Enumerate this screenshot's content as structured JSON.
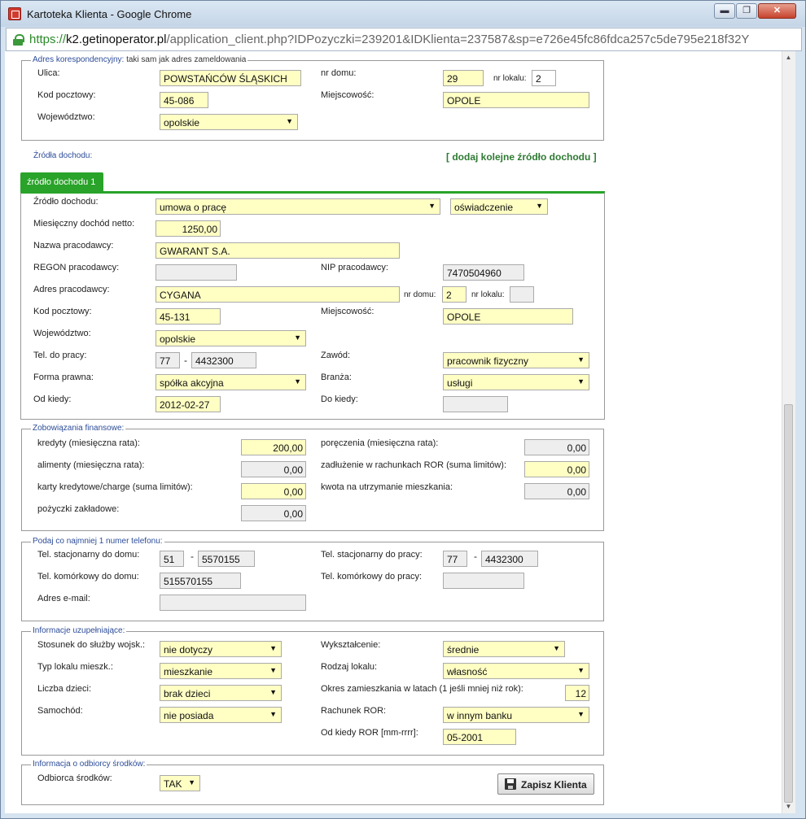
{
  "window": {
    "title": "Kartoteka Klienta - Google Chrome",
    "min": "▬",
    "max": "❐",
    "close": "✕"
  },
  "address": {
    "scheme": "https://",
    "host": "k2.getinoperator.pl",
    "path": "/application_client.php?IDPozyczki=239201&IDKlienta=237587&sp=e726e45fc86fdca257c5de795e218f32Y"
  },
  "corr": {
    "legend": "Adres korespondencyjny:",
    "legend_sub": "taki sam jak adres zameldowania",
    "ulica_label": "Ulica:",
    "ulica": "POWSTAŃCÓW ŚLĄSKICH",
    "nr_domu_label": "nr domu:",
    "nr_domu": "29",
    "nr_lokalu_label": "nr lokalu:",
    "nr_lokalu": "2",
    "kod_label": "Kod pocztowy:",
    "kod": "45-086",
    "miejsc_label": "Miejscowość:",
    "miejsc": "OPOLE",
    "woj_label": "Województwo:",
    "woj": "opolskie"
  },
  "income": {
    "section_label": "Źródła dochodu:",
    "add_link": "[ dodaj kolejne źródło dochodu ]",
    "tab": "źródło dochodu 1",
    "zrodlo_label": "Źródło dochodu:",
    "zrodlo": "umowa o pracę",
    "dokument": "oświadczenie",
    "dochod_label": "Miesięczny dochód netto:",
    "dochod": "1250,00",
    "nazwa_label": "Nazwa pracodawcy:",
    "nazwa": "GWARANT S.A.",
    "regon_label": "REGON pracodawcy:",
    "regon": "",
    "nip_label": "NIP pracodawcy:",
    "nip": "7470504960",
    "adres_label": "Adres pracodawcy:",
    "adres": "CYGANA",
    "nr_domu_label": "nr domu:",
    "nr_domu": "2",
    "nr_lokalu_label": "nr lokalu:",
    "nr_lokalu": "",
    "kod_label": "Kod pocztowy:",
    "kod": "45-131",
    "miejsc_label": "Miejscowość:",
    "miejsc": "OPOLE",
    "woj_label": "Województwo:",
    "woj": "opolskie",
    "tel_label": "Tel. do pracy:",
    "tel_kier": "77",
    "tel_dash": "-",
    "tel_num": "4432300",
    "zawod_label": "Zawód:",
    "zawod": "pracownik fizyczny",
    "forma_label": "Forma prawna:",
    "forma": "spółka akcyjna",
    "branza_label": "Branża:",
    "branza": "usługi",
    "od_label": "Od kiedy:",
    "od": "2012-02-27",
    "do_label": "Do kiedy:",
    "do": ""
  },
  "fin": {
    "legend": "Zobowiązania finansowe:",
    "kredyty_label": "kredyty (miesięczna rata):",
    "kredyty": "200,00",
    "poreczenia_label": "poręczenia (miesięczna rata):",
    "poreczenia": "0,00",
    "alimenty_label": "alimenty (miesięczna rata):",
    "alimenty": "0,00",
    "zadluzenie_label": "zadłużenie w rachunkach ROR (suma limitów):",
    "zadluzenie": "0,00",
    "karty_label": "karty kredytowe/charge (suma limitów):",
    "karty": "0,00",
    "kwota_label": "kwota na utrzymanie mieszkania:",
    "kwota": "0,00",
    "pozyczki_label": "pożyczki zakładowe:",
    "pozyczki": "0,00"
  },
  "phone": {
    "legend": "Podaj co najmniej 1 numer telefonu:",
    "dom_label": "Tel. stacjonarny do domu:",
    "dom_kier": "51",
    "dom_num": "5570155",
    "dash": "-",
    "praca_label": "Tel. stacjonarny do pracy:",
    "praca_kier": "77",
    "praca_num": "4432300",
    "kom_dom_label": "Tel. komórkowy do domu:",
    "kom_dom": "515570155",
    "kom_praca_label": "Tel. komórkowy do pracy:",
    "kom_praca": "",
    "email_label": "Adres e-mail:",
    "email": ""
  },
  "extra": {
    "legend": "Informacje uzupełniające:",
    "wojsko_label": "Stosunek do służby wojsk.:",
    "wojsko": "nie dotyczy",
    "wykszt_label": "Wykształcenie:",
    "wykszt": "średnie",
    "typ_label": "Typ lokalu mieszk.:",
    "typ": "mieszkanie",
    "rodzaj_label": "Rodzaj lokalu:",
    "rodzaj": "własność",
    "dzieci_label": "Liczba dzieci:",
    "dzieci": "brak dzieci",
    "okres_label": "Okres zamieszkania w latach (1 jeśli mniej niż rok):",
    "okres": "12",
    "samochod_label": "Samochód:",
    "samochod": "nie posiada",
    "ror_label": "Rachunek ROR:",
    "ror": "w innym banku",
    "ror_od_label": "Od kiedy ROR [mm-rrrr]:",
    "ror_od": "05-2001"
  },
  "recipient": {
    "legend": "Informacja o odbiorcy środków:",
    "label": "Odbiorca środków:",
    "value": "TAK"
  },
  "save_button": "Zapisz Klienta",
  "arrow": "▼"
}
